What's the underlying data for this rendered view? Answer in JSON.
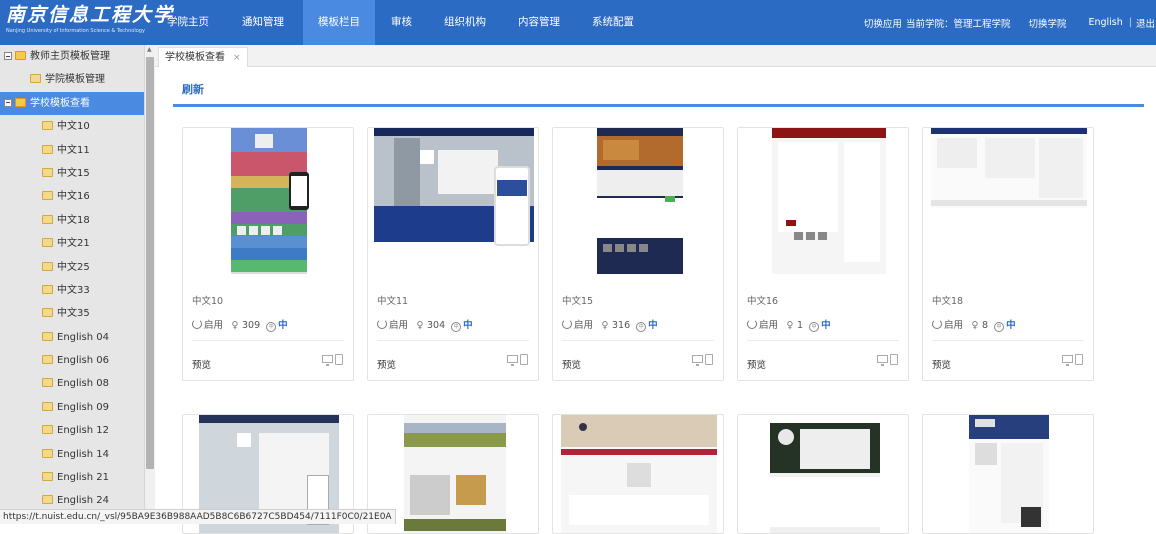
{
  "header": {
    "logo_cn": "南京信息工程大学",
    "logo_en": "Nanjing University of Information Science & Technology",
    "nav": [
      {
        "label": "学院主页",
        "active": false
      },
      {
        "label": "通知管理",
        "active": false
      },
      {
        "label": "模板栏目",
        "active": true
      },
      {
        "label": "审核",
        "active": false
      },
      {
        "label": "组织机构",
        "active": false
      },
      {
        "label": "内容管理",
        "active": false
      },
      {
        "label": "系统配置",
        "active": false
      }
    ],
    "switch_app": "切换应用",
    "current_college": "当前学院：管理工程学院",
    "switch_college": "切换学院",
    "english": "English",
    "separator": "|",
    "logout": "退出"
  },
  "sidebar": {
    "tree": [
      {
        "label": "教师主页模板管理",
        "level": 0,
        "toggle": true,
        "folder": true,
        "selected": false
      },
      {
        "label": "学院模板管理",
        "level": 1,
        "toggle": false,
        "folder": false,
        "selected": false
      },
      {
        "label": "学校模板查看",
        "level": 0,
        "toggle": true,
        "folder": true,
        "selected": true
      },
      {
        "label": "中文10",
        "level": 2,
        "selected": false
      },
      {
        "label": "中文11",
        "level": 2,
        "selected": false
      },
      {
        "label": "中文15",
        "level": 2,
        "selected": false
      },
      {
        "label": "中文16",
        "level": 2,
        "selected": false
      },
      {
        "label": "中文18",
        "level": 2,
        "selected": false
      },
      {
        "label": "中文21",
        "level": 2,
        "selected": false
      },
      {
        "label": "中文25",
        "level": 2,
        "selected": false
      },
      {
        "label": "中文33",
        "level": 2,
        "selected": false
      },
      {
        "label": "中文35",
        "level": 2,
        "selected": false
      },
      {
        "label": "English 04",
        "level": 2,
        "selected": false
      },
      {
        "label": "English 06",
        "level": 2,
        "selected": false
      },
      {
        "label": "English 08",
        "level": 2,
        "selected": false
      },
      {
        "label": "English 09",
        "level": 2,
        "selected": false
      },
      {
        "label": "English 12",
        "level": 2,
        "selected": false
      },
      {
        "label": "English 14",
        "level": 2,
        "selected": false
      },
      {
        "label": "English 21",
        "level": 2,
        "selected": false
      },
      {
        "label": "English 24",
        "level": 2,
        "selected": false
      }
    ]
  },
  "tab": {
    "label": "学校模板查看",
    "close": "×"
  },
  "toolbar": {
    "refresh": "刷新"
  },
  "cards": [
    {
      "name": "中文10",
      "status": "启用",
      "users": "309",
      "lang": "中",
      "lang_icon": "中",
      "preview": "预览",
      "thumb": "colorful-bands"
    },
    {
      "name": "中文11",
      "status": "启用",
      "users": "304",
      "lang": "中",
      "lang_icon": "中",
      "preview": "预览",
      "thumb": "library-banner"
    },
    {
      "name": "中文15",
      "status": "启用",
      "users": "316",
      "lang": "中",
      "lang_icon": "中",
      "preview": "预览",
      "thumb": "forest-navy"
    },
    {
      "name": "中文16",
      "status": "启用",
      "users": "1",
      "lang": "中",
      "lang_icon": "中",
      "preview": "预览",
      "thumb": "maroon-header"
    },
    {
      "name": "中文18",
      "status": "启用",
      "users": "8",
      "lang": "中",
      "lang_icon": "中",
      "preview": "预览",
      "thumb": "navy-text"
    }
  ],
  "cards_row2": [
    {
      "thumb": "grey-mobile"
    },
    {
      "thumb": "field-landscape"
    },
    {
      "thumb": "blossom-header"
    },
    {
      "thumb": "dark-forest"
    },
    {
      "thumb": "city-night"
    }
  ],
  "status_bar": {
    "url": "https://t.nuist.edu.cn/_vsl/95BA9E36B988AAD5B8C6B6727C5BD454/7111F0C0/21E0A"
  }
}
